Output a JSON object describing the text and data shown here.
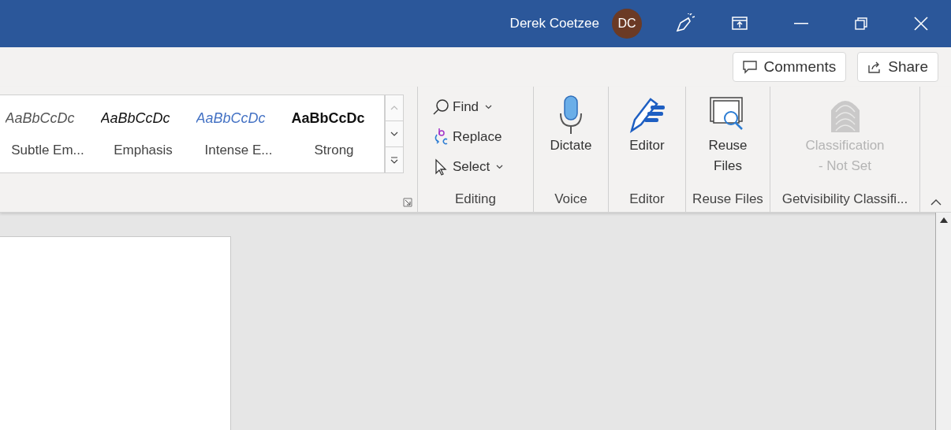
{
  "title_bar": {
    "user_name": "Derek Coetzee",
    "avatar_initials": "DC"
  },
  "actions": [
    {
      "label": "Comments",
      "kind": "comments"
    },
    {
      "label": "Share",
      "kind": "share"
    }
  ],
  "styles": [
    {
      "sample": "AaBbCcDc",
      "name": "Subtle Em...",
      "kind": "subtle"
    },
    {
      "sample": "AaBbCcDc",
      "name": "Emphasis",
      "kind": "emphasis"
    },
    {
      "sample": "AaBbCcDc",
      "name": "Intense E...",
      "kind": "intense"
    },
    {
      "sample": "AaBbCcDc",
      "name": "Strong",
      "kind": "strong"
    }
  ],
  "editing": {
    "label": "Editing",
    "items": [
      {
        "label": "Find",
        "kind": "find",
        "dropdown": true
      },
      {
        "label": "Replace",
        "kind": "replace",
        "dropdown": false
      },
      {
        "label": "Select",
        "kind": "select",
        "dropdown": true
      }
    ]
  },
  "groups": [
    {
      "kind": "dictate",
      "buttons": [
        "Dictate"
      ],
      "label": "Voice",
      "disabled": false
    },
    {
      "kind": "editor",
      "buttons": [
        "Editor"
      ],
      "label": "Editor",
      "disabled": false
    },
    {
      "kind": "reuse",
      "buttons": [
        "Reuse",
        "Files"
      ],
      "label": "Reuse Files",
      "disabled": false
    },
    {
      "kind": "classification",
      "buttons": [
        "Classification",
        "- Not Set"
      ],
      "label": "Getvisibility Classifi...",
      "disabled": true
    }
  ]
}
